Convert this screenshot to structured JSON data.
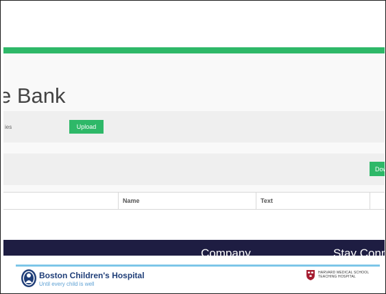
{
  "header": {
    "title": "e Bank"
  },
  "upload_panel": {
    "label": "ies",
    "button_label": "Upload"
  },
  "download_panel": {
    "button_label": "Dow"
  },
  "table": {
    "columns": [
      "",
      "Name",
      "Text",
      ""
    ]
  },
  "footer": {
    "company": "Company",
    "stay_connected": "Stay Conn"
  },
  "branding": {
    "hospital_name": "Boston Children's Hospital",
    "tagline": "Until every child is well",
    "harvard_line1": "HARVARD MEDICAL SCHOOL",
    "harvard_line2": "TEACHING HOSPITAL"
  },
  "colors": {
    "accent_green": "#2eb868",
    "footer_navy": "#1e1d42",
    "divider_blue": "#7cc6e8",
    "brand_blue": "#1f3e78",
    "harvard_crimson": "#a51c30"
  }
}
